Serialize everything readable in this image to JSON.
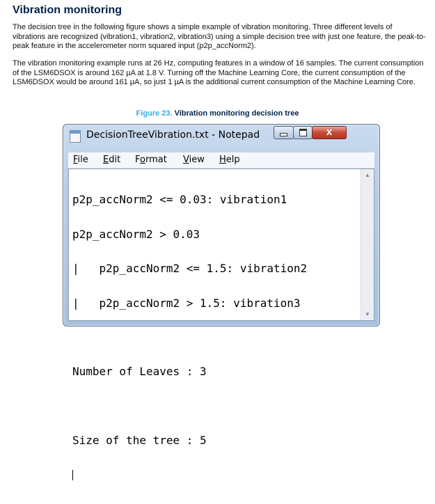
{
  "doc": {
    "heading": "Vibration monitoring",
    "paragraph1": "The decision tree in the following figure shows a simple example of vibration monitoring. Three different levels of vibrations are recognized (vibration1, vibration2, vibration3) using a simple decision tree with just one feature, the peak-to-peak feature in the accelerometer norm squared input (p2p_accNorm2).",
    "paragraph2": "The vibration monitoring example runs at 26 Hz, computing features in a window of 16 samples. The current consumption of the LSM6DSOX is around 162 µA at 1.8 V. Turning off the Machine Learning Core, the current consumption of the LSM6DSOX would be around 161 µA, so just 1 µA is the additional current consumption of the Machine Learning Core.",
    "figure_label": "Figure 23.",
    "figure_title": "Vibration monitoring decision tree"
  },
  "window": {
    "title": "DecisionTreeVibration.txt - Notepad",
    "close_glyph": "X",
    "menu": {
      "file": {
        "ul": "F",
        "rest": "ile"
      },
      "edit": {
        "ul": "E",
        "rest": "dit"
      },
      "format": {
        "pre": "F",
        "ul": "o",
        "rest": "rmat"
      },
      "view": {
        "ul": "V",
        "rest": "iew"
      },
      "help": {
        "ul": "H",
        "rest": "elp"
      }
    },
    "lines": [
      "p2p_accNorm2 <= 0.03: vibration1",
      "p2p_accNorm2 > 0.03",
      "|   p2p_accNorm2 <= 1.5: vibration2",
      "|   p2p_accNorm2 > 1.5: vibration3"
    ],
    "leaves_line": "Number of Leaves : 3",
    "size_line": "Size of the tree : 5",
    "scroll_up_glyph": "▲",
    "scroll_down_glyph": "▼"
  }
}
